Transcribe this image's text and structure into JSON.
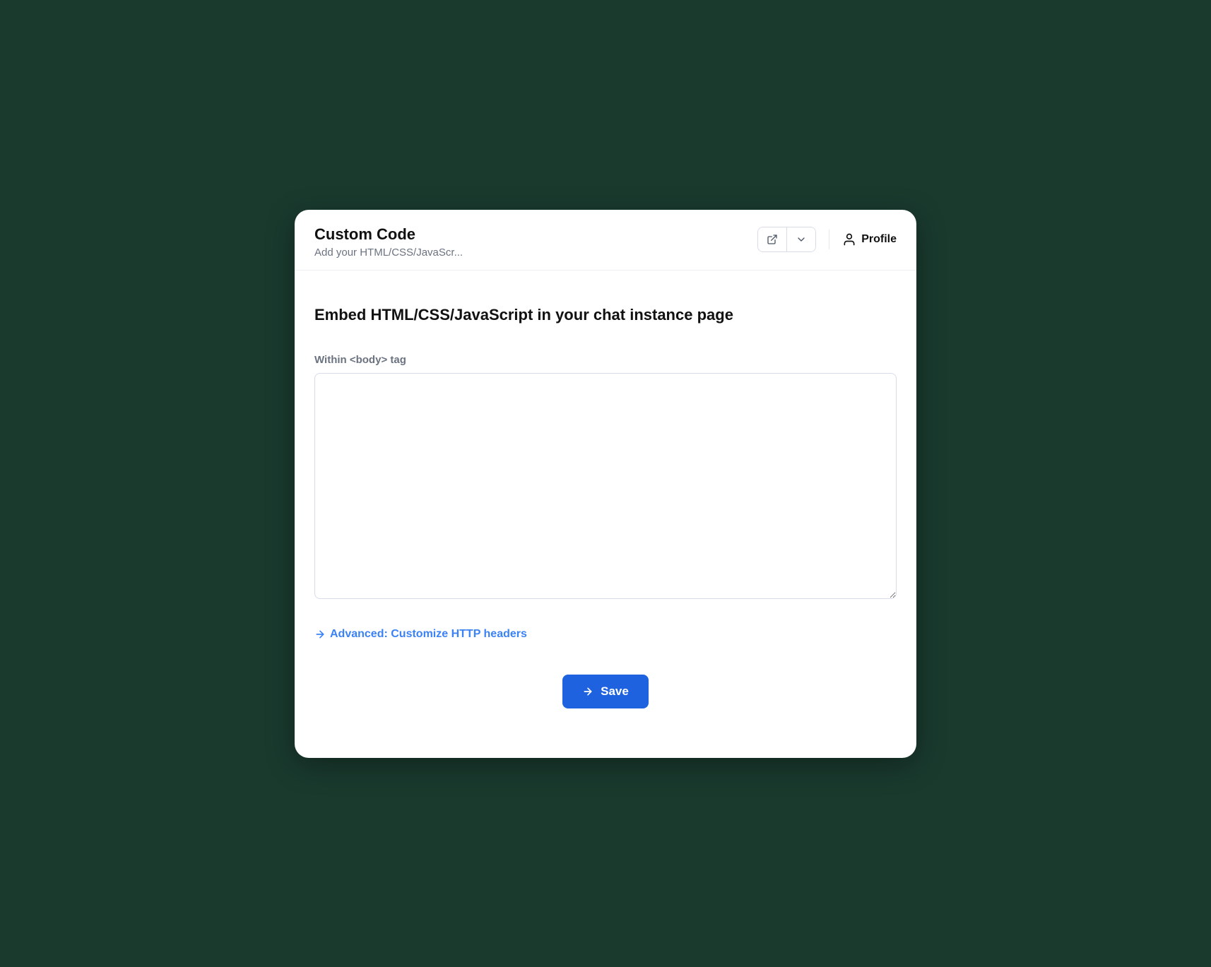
{
  "header": {
    "title": "Custom Code",
    "subtitle": "Add your HTML/CSS/JavaScr...",
    "profile_label": "Profile"
  },
  "main": {
    "section_title": "Embed HTML/CSS/JavaScript in your chat instance page",
    "body_label": "Within <body> tag",
    "code_value": "",
    "advanced_label": "Advanced: Customize HTTP headers",
    "save_label": "Save"
  },
  "colors": {
    "primary": "#1f62e0",
    "link": "#3b82f6",
    "muted": "#6b7280",
    "border": "#d9dbe9"
  }
}
